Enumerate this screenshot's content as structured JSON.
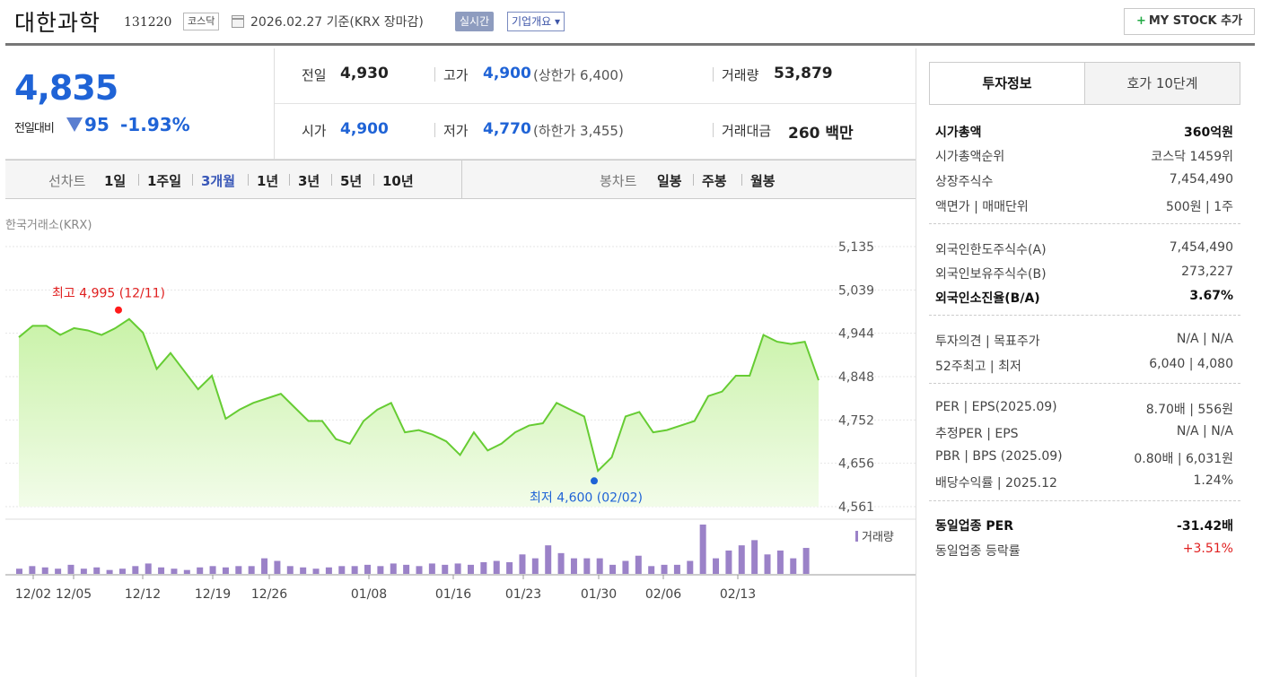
{
  "header": {
    "company": "대한과학",
    "code": "131220",
    "market": "코스닥",
    "date_text": "2026.02.27  기준(KRX 장마감)",
    "realtime": "실시간",
    "overview": "기업개요 ▾",
    "mystock": "MY STOCK 추가"
  },
  "quote": {
    "price": "4,835",
    "change_label": "전일대비",
    "change": "95",
    "change_pct": "-1.93%",
    "prev_label": "전일",
    "prev": "4,930",
    "high_label": "고가",
    "high": "4,900",
    "upper_limit": "(상한가 6,400)",
    "volume_label": "거래량",
    "volume": "53,879",
    "open_label": "시가",
    "open": "4,900",
    "low_label": "저가",
    "low": "4,770",
    "lower_limit": "(하한가 3,455)",
    "amount_label": "거래대금",
    "amount": "260 백만"
  },
  "tabs": {
    "line_chart": "선차트",
    "line_periods": [
      "1일",
      "1주일",
      "3개월",
      "1년",
      "3년",
      "5년",
      "10년"
    ],
    "selected": "3개월",
    "candle_chart": "봉차트",
    "candle_periods": [
      "일봉",
      "주봉",
      "월봉"
    ]
  },
  "chart_source": "한국거래소(KRX)",
  "chart_data": {
    "type": "area",
    "x_ticks": [
      "12/02",
      "12/05",
      "12/12",
      "12/19",
      "12/26",
      "01/08",
      "01/16",
      "01/23",
      "01/30",
      "02/06",
      "02/13"
    ],
    "y_ticks": [
      "5,135",
      "5,039",
      "4,944",
      "4,848",
      "4,752",
      "4,656",
      "4,561"
    ],
    "ylim": [
      4561,
      5135
    ],
    "high_label": "최고 4,995 (12/11)",
    "low_label": "최저 4,600 (02/02)",
    "volume_label": "거래량",
    "price_series": [
      4935,
      4960,
      4960,
      4940,
      4955,
      4950,
      4940,
      4955,
      4975,
      4945,
      4865,
      4900,
      4860,
      4820,
      4850,
      4755,
      4775,
      4790,
      4800,
      4810,
      4780,
      4750,
      4750,
      4710,
      4700,
      4750,
      4775,
      4790,
      4725,
      4730,
      4720,
      4705,
      4675,
      4725,
      4685,
      4700,
      4725,
      4740,
      4745,
      4790,
      4775,
      4760,
      4640,
      4670,
      4760,
      4770,
      4725,
      4730,
      4740,
      4750,
      4805,
      4815,
      4850,
      4850,
      4940,
      4925,
      4920,
      4925,
      4840
    ],
    "volume_series": [
      4,
      6,
      5,
      4,
      7,
      4,
      5,
      3,
      4,
      6,
      8,
      5,
      4,
      3,
      5,
      6,
      5,
      6,
      6,
      12,
      10,
      6,
      5,
      4,
      5,
      6,
      6,
      7,
      6,
      8,
      7,
      6,
      8,
      7,
      8,
      7,
      9,
      10,
      9,
      15,
      12,
      22,
      16,
      12,
      12,
      12,
      7,
      10,
      14,
      6,
      7,
      7,
      10,
      38,
      12,
      18,
      22,
      26,
      15,
      18,
      12,
      20
    ]
  },
  "invest": {
    "tab_on": "투자정보",
    "tab_off": "호가 10단계",
    "rows": [
      {
        "l": "시가총액",
        "r": "360억원",
        "bold": true
      },
      {
        "l": "시가총액순위",
        "r": "코스닥 1459위"
      },
      {
        "l": "상장주식수",
        "r": "7,454,490"
      },
      {
        "l": "액면가 | 매매단위",
        "r": "500원 | 1주"
      },
      {
        "l": "외국인한도주식수(A)",
        "r": "7,454,490"
      },
      {
        "l": "외국인보유주식수(B)",
        "r": "273,227"
      },
      {
        "l": "외국인소진율(B/A)",
        "r": "3.67%",
        "bold": true
      },
      {
        "l": "투자의견 | 목표주가",
        "r": "N/A | N/A"
      },
      {
        "l": "52주최고 | 최저",
        "r": "6,040 | 4,080"
      },
      {
        "l": "PER | EPS(2025.09)",
        "r": "8.70배 | 556원"
      },
      {
        "l": "추정PER | EPS",
        "r": "N/A | N/A"
      },
      {
        "l": "PBR | BPS (2025.09)",
        "r": "0.80배 | 6,031원"
      },
      {
        "l": "배당수익률 | 2025.12",
        "r": "1.24%"
      },
      {
        "l": "동일업종 PER",
        "r": "-31.42배",
        "bold": true
      },
      {
        "l": "동일업종 등락률",
        "r": "+3.51%",
        "red": true
      }
    ]
  },
  "colors": {
    "accent": "#1f63d6",
    "area_fill": "#c9f2a8",
    "line": "#66cc33",
    "volume": "#9b82c8",
    "up": "#e02020"
  }
}
